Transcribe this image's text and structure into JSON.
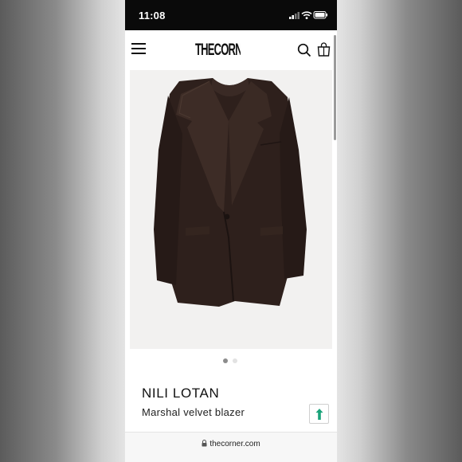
{
  "status_bar": {
    "time": "11:08",
    "icons": [
      "signal-icon",
      "wifi-icon",
      "battery-icon"
    ]
  },
  "header": {
    "logo": "THECORNER.COM",
    "icons": [
      "hamburger-menu-icon",
      "search-icon",
      "shopping-bag-icon"
    ]
  },
  "gallery": {
    "image": "brown velvet single-breasted blazer with peak lapels",
    "slide_count": 2,
    "active_slide": 1
  },
  "product": {
    "brand": "NILI LOTAN",
    "name": "Marshal velvet blazer",
    "share_icon": "share-icon"
  },
  "browser": {
    "url": "thecorner.com",
    "lock_icon": "lock-icon"
  },
  "colors": {
    "blazer": "#2e201c",
    "share_accent": "#1aa37a",
    "status_bar_bg": "#0a0a0a",
    "dot_active": "#8c8c8c",
    "dot_inactive": "#e2e2e2"
  }
}
